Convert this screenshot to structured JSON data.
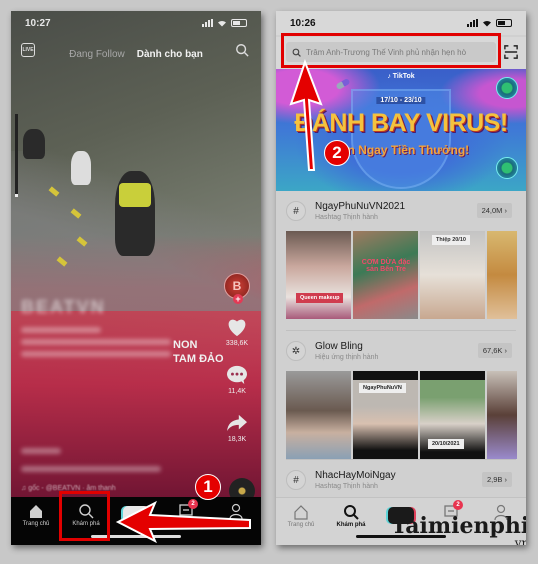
{
  "left_screen": {
    "status": {
      "time": "10:27",
      "location_icon": "location-arrow-icon",
      "signal_icon": "signal-icon",
      "wifi_icon": "wifi-icon",
      "battery_icon": "battery-icon"
    },
    "top_nav": {
      "live_label": "LIVE",
      "following_label": "Đang Follow",
      "for_you_label": "Dành cho bạn",
      "search_icon": "search-icon"
    },
    "video": {
      "watermark": "BEATVN",
      "caption_visible_right": [
        "NON",
        "TAM ĐẢO"
      ],
      "music_line": "♫ gốc - @BEATVN · âm thanh"
    },
    "actions": {
      "likes": "338,6K",
      "comments": "11,4K",
      "shares": "18,3K",
      "avatar_letter": "B"
    },
    "tabbar": {
      "items": [
        {
          "label": "Trang chủ",
          "icon": "home-icon"
        },
        {
          "label": "Khám phá",
          "icon": "search-icon"
        },
        {
          "label": "",
          "icon": "plus-icon"
        },
        {
          "label": "",
          "icon": "inbox-icon",
          "badge": "2"
        },
        {
          "label": "",
          "icon": "profile-icon"
        }
      ]
    }
  },
  "right_screen": {
    "status": {
      "time": "10:26"
    },
    "search": {
      "placeholder": "Trâm Anh-Trương Thế Vinh phủ nhận hẹn hò",
      "scan_icon": "scan-icon"
    },
    "banner": {
      "brand": "♪ TikTok",
      "date_range": "17/10 - 23/10",
      "title": "ĐÁNH BAY VIRUS!",
      "subtitle": "Săn Ngay Tiền Thưởng!"
    },
    "sections": [
      {
        "icon": "#",
        "title": "NgayPhuNuVN2021",
        "subtitle": "Hashtag Thịnh hành",
        "count": "24,0M ›",
        "thumb_labels": [
          "Queen makeup",
          "CƠM DỪA đặc sản Bến Tre",
          "Thiệp 20/10",
          ""
        ]
      },
      {
        "icon": "✲",
        "title": "Glow Bling",
        "subtitle": "Hiệu ứng thịnh hành",
        "count": "67,6K ›",
        "thumb_labels": [
          "",
          "NgayPhuNuVN",
          "20/10/2021",
          ""
        ]
      },
      {
        "icon": "#",
        "title": "NhacHayMoiNgay",
        "subtitle": "Hashtag Thịnh hành",
        "count": "2,9B ›"
      }
    ],
    "tabbar": {
      "items": [
        {
          "label": "Trang chủ",
          "icon": "home-icon"
        },
        {
          "label": "Khám phá",
          "icon": "search-icon",
          "active": true
        },
        {
          "label": "",
          "icon": "plus-icon"
        },
        {
          "label": "",
          "icon": "inbox-icon",
          "badge": "2"
        },
        {
          "label": "",
          "icon": "profile-icon"
        }
      ]
    }
  },
  "annotations": {
    "step1": "1",
    "step2": "2",
    "highlight_color": "#e10000"
  },
  "watermark_brand": {
    "main": "Taimienphi",
    "tld": ".vn"
  }
}
